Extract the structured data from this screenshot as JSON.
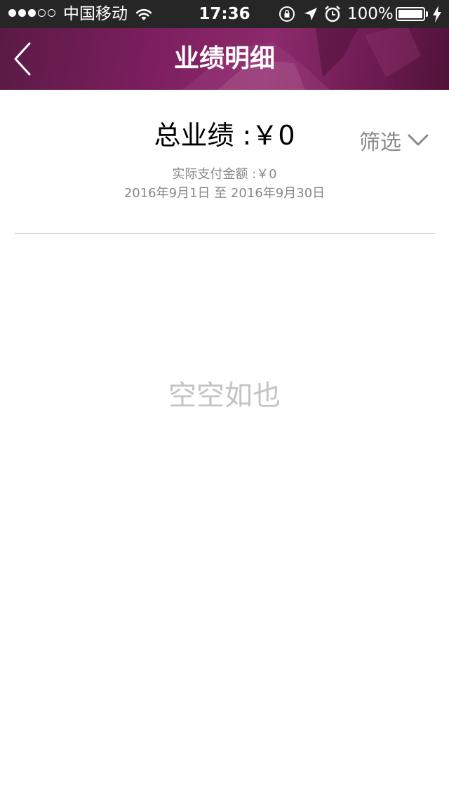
{
  "status_bar": {
    "carrier": "中国移动",
    "time": "17:36",
    "battery": "100%",
    "signal_bars_filled": 3,
    "signal_bars_total": 5
  },
  "nav": {
    "title": "业绩明细",
    "back_icon": "chevron-left-icon"
  },
  "summary": {
    "total_label": "总业绩 :",
    "total_value": "￥0",
    "filter_label": "筛选",
    "paid_label": "实际支付金额 :",
    "paid_value": "￥0",
    "date_range": "2016年9月1日 至 2016年9月30日"
  },
  "empty_state": {
    "text": "空空如也"
  },
  "colors": {
    "nav_background": "#7d1f5f",
    "status_bar": "#262626",
    "secondary_text": "#888888",
    "empty_text": "#c4c4c4"
  }
}
